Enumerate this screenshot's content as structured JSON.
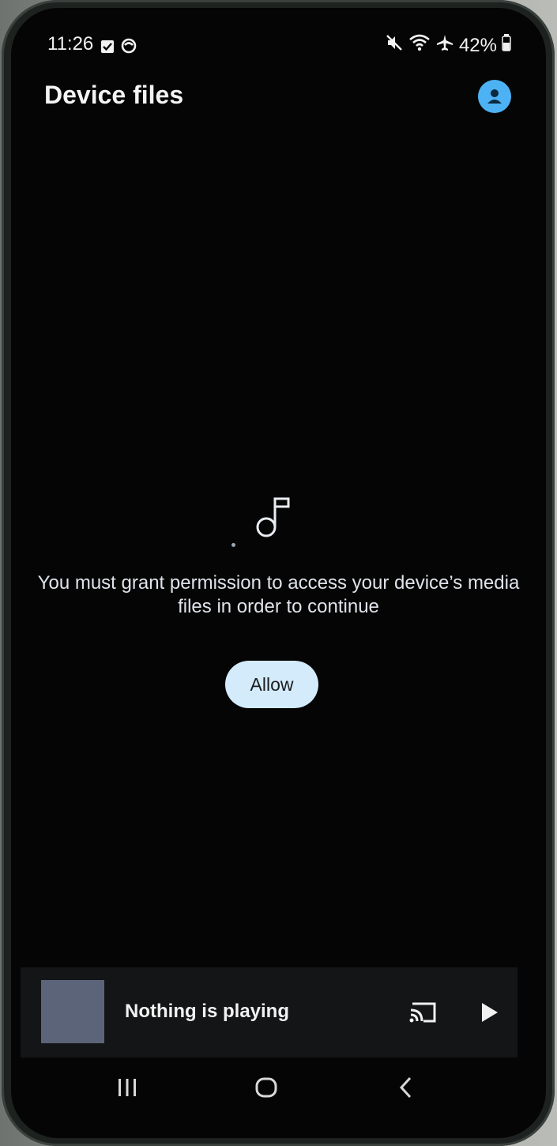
{
  "status_bar": {
    "time": "11:26",
    "battery": "42%"
  },
  "app_bar": {
    "title": "Device files"
  },
  "empty_state": {
    "message": "You must grant permission to access your device’s media files in order to continue",
    "allow_label": "Allow"
  },
  "mini_player": {
    "status": "Nothing is playing"
  },
  "colors": {
    "accent": "#4db2f4",
    "button_bg": "#d4ebfb",
    "background": "#050505"
  }
}
